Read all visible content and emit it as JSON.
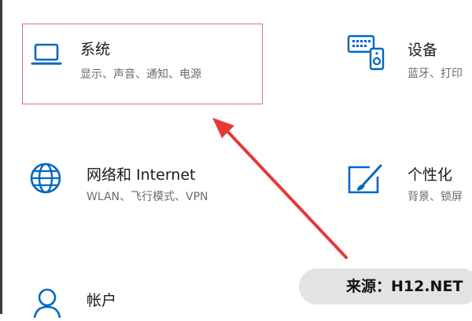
{
  "settings": {
    "tiles": [
      {
        "id": "system",
        "title": "系统",
        "subtitle": "显示、声音、通知、电源",
        "icon": "laptop-icon"
      },
      {
        "id": "devices",
        "title": "设备",
        "subtitle": "蓝牙、打印",
        "icon": "keyboard-speaker-icon"
      },
      {
        "id": "network",
        "title": "网络和 Internet",
        "subtitle": "WLAN、飞行模式、VPN",
        "icon": "globe-icon"
      },
      {
        "id": "personalization",
        "title": "个性化",
        "subtitle": "背景、锁屏",
        "icon": "paint-brush-icon"
      },
      {
        "id": "accounts",
        "title": "帐户",
        "subtitle": "",
        "icon": "person-icon"
      }
    ]
  },
  "watermark": {
    "text": "来源：H12.NET"
  },
  "colors": {
    "accent": "#0067c0",
    "highlight_border": "#e07070",
    "arrow": "#e53935"
  }
}
